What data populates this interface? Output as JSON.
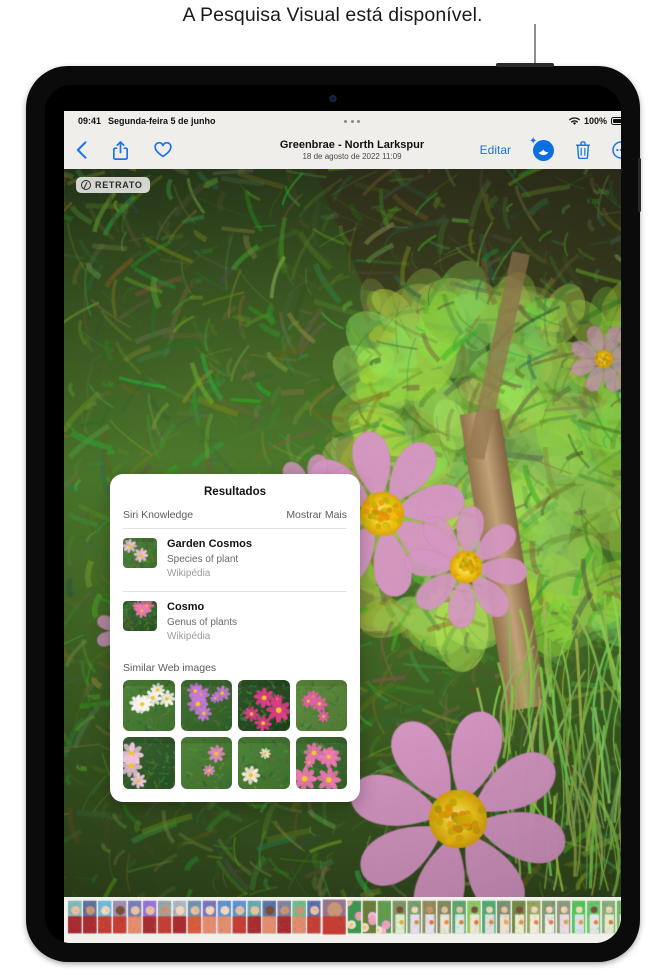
{
  "callout": {
    "text": "A Pesquisa Visual está disponível.",
    "line_color": "#8e8e8e"
  },
  "device": {
    "type": "ipad",
    "frame_color": "#0b0b0c"
  },
  "status_bar": {
    "time": "09:41",
    "date": "Segunda-feira 5 de junho",
    "battery_percent": "100%",
    "wifi_icon": "wifi-icon",
    "battery_icon": "battery-full-icon",
    "multitask_icon": "multitasking-dots-icon"
  },
  "toolbar": {
    "back_icon": "chevron-left-icon",
    "share_icon": "share-icon",
    "favorite_icon": "heart-icon",
    "title": "Greenbrae - North Larkspur",
    "subtitle": "18 de agosto de 2022  11:09",
    "edit_label": "Editar",
    "visual_lookup_icon": "visual-look-up-icon",
    "delete_icon": "trash-icon",
    "more_icon": "ellipsis-circle-icon",
    "accent_color": "#1a73ea",
    "visual_lookup_color": "#0a6fe0"
  },
  "photo": {
    "badge_label": "RETRATO",
    "badge_icon": "aperture-icon",
    "description": "Garden cosmos flowers in a vegetable garden"
  },
  "results_popup": {
    "title": "Resultados",
    "section_label": "Siri Knowledge",
    "show_more_label": "Mostrar Mais",
    "knowledge_items": [
      {
        "name": "Garden Cosmos",
        "description": "Species of plant",
        "source": "Wikipédia",
        "thumb_icon": "pink-cosmos-flower-thumb"
      },
      {
        "name": "Cosmo",
        "description": "Genus of plants",
        "source": "Wikipédia",
        "thumb_icon": "cosmos-field-thumb"
      }
    ],
    "similar_images_label": "Similar Web images",
    "similar_images": [
      {
        "name": "pink-cosmos-in-grass"
      },
      {
        "name": "white-cosmos-cluster"
      },
      {
        "name": "magenta-cosmos-closeup"
      },
      {
        "name": "cream-cosmos-blooms"
      },
      {
        "name": "purple-cosmos-garden"
      },
      {
        "name": "pale-pink-cosmos-closeup"
      },
      {
        "name": "pink-cosmos-meadow"
      },
      {
        "name": "deep-pink-cosmos-patch"
      }
    ]
  },
  "filmstrip": {
    "selected_index": 17,
    "thumb_count": 38
  },
  "home_indicator": {
    "label": "home-indicator"
  }
}
